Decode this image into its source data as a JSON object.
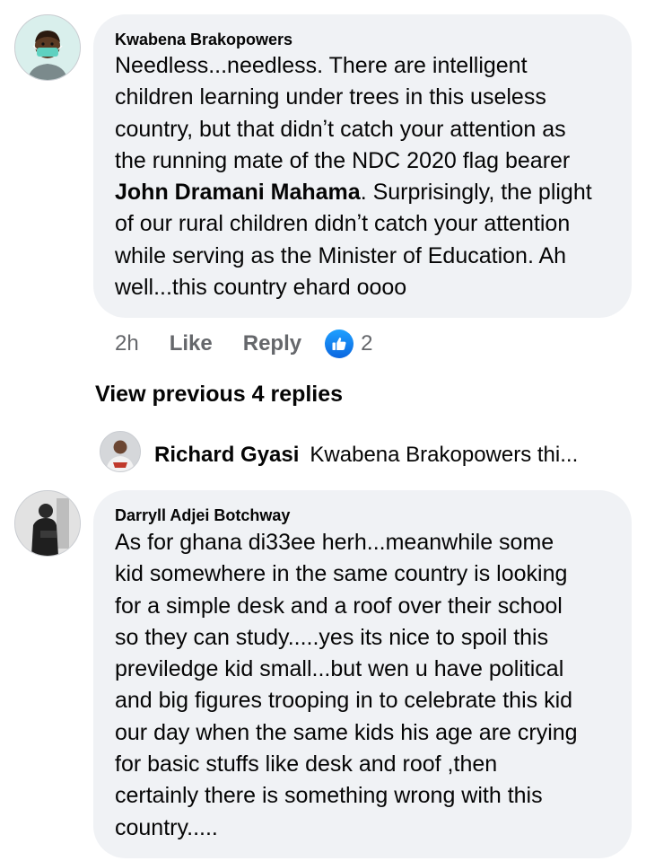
{
  "comments": [
    {
      "author": "Kwabena Brakopowers",
      "avatar_icon": "masked-person-avatar-icon",
      "lines": [
        [
          "Needless...needless. There are intelligent"
        ],
        [
          "children learning under trees in this useless"
        ],
        [
          "country, but that didnʼt catch your attention as"
        ],
        [
          "the running mate of the NDC 2020 flag bearer"
        ],
        [
          "John Dramani Mahama",
          ". Surprisingly, the plight"
        ],
        [
          "of our rural children didnʼt catch your attention"
        ],
        [
          "while serving as the Minister of Education. Ah"
        ],
        [
          "well...this country ehard oooo"
        ]
      ],
      "time": "2h",
      "like_label": "Like",
      "reply_label": "Reply",
      "reaction_icon": "thumbs-up-icon",
      "reaction_count": "2"
    },
    {
      "author": "Darryll Adjei Botchway",
      "avatar_icon": "person-photo-avatar-icon",
      "lines": [
        [
          "As for ghana di33ee herh...meanwhile some"
        ],
        [
          "kid somewhere in the same country is looking"
        ],
        [
          "for a simple desk and a roof over their school"
        ],
        [
          "so they can study.....yes its nice to spoil this"
        ],
        [
          "previledge kid small...but wen u have political"
        ],
        [
          "and big figures trooping in to celebrate this kid"
        ],
        [
          "our day  when the same kids his age are crying"
        ],
        [
          "for basic stuffs like desk and roof ,then"
        ],
        [
          "certainly there is something wrong with this"
        ],
        [
          "country....."
        ]
      ]
    }
  ],
  "view_previous": "View previous 4 replies",
  "reply_preview": {
    "name": "Richard Gyasi",
    "text": "Kwabena Brakopowers thi..."
  },
  "colors": {
    "bubble": "#f0f2f5",
    "meta": "#65676b",
    "like_blue": "#1877f2"
  }
}
